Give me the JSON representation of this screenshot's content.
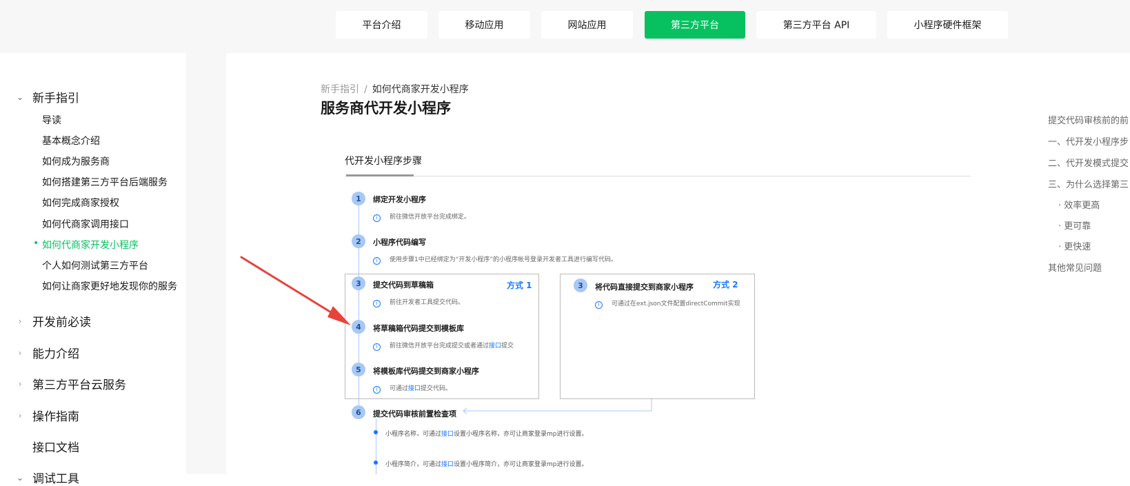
{
  "nav": {
    "items": [
      {
        "label": "平台介绍"
      },
      {
        "label": "移动应用"
      },
      {
        "label": "网站应用"
      },
      {
        "label": "第三方平台"
      },
      {
        "label": "第三方平台 API"
      },
      {
        "label": "小程序硬件框架"
      }
    ],
    "active_color": "#07c160"
  },
  "sidebar": {
    "sections": [
      {
        "label": "新手指引",
        "expanded": true,
        "icon": "chevron-down-icon"
      },
      {
        "label": "开发前必读",
        "icon": "chevron-right-icon"
      },
      {
        "label": "能力介绍",
        "icon": "chevron-right-icon"
      },
      {
        "label": "第三方平台云服务",
        "icon": "chevron-right-icon"
      },
      {
        "label": "操作指南",
        "icon": "chevron-right-icon"
      },
      {
        "label": "接口文档"
      },
      {
        "label": "调试工具",
        "icon": "chevron-down-icon"
      }
    ],
    "sub_items": [
      {
        "label": "导读"
      },
      {
        "label": "基本概念介绍"
      },
      {
        "label": "如何成为服务商"
      },
      {
        "label": "如何搭建第三方平台后端服务"
      },
      {
        "label": "如何完成商家授权"
      },
      {
        "label": "如何代商家调用接口"
      },
      {
        "label": "如何代商家开发小程序",
        "current": true
      },
      {
        "label": "个人如何测试第三方平台"
      },
      {
        "label": "如何让商家更好地发现你的服务"
      }
    ]
  },
  "main": {
    "breadcrumb": {
      "parent": "新手指引",
      "separator": "/",
      "current": "如何代商家开发小程序"
    },
    "title": "服务商代开发小程序",
    "tab": "代开发小程序步骤",
    "diagram": {
      "method1": "方式 1",
      "method2": "方式 2",
      "steps": [
        {
          "num": "1",
          "title": "绑定开发小程序",
          "desc": "前往微信开放平台完成绑定。"
        },
        {
          "num": "2",
          "title": "小程序代码编写",
          "desc": "使用步骤1中已经绑定为“开发小程序”的小程序帐号登录开发者工具进行编写代码。"
        },
        {
          "num": "3",
          "title": "提交代码到草稿箱",
          "desc": "前往开发者工具提交代码。"
        },
        {
          "num": "4",
          "title": "将草稿箱代码提交到模板库",
          "desc_pre": "前往微信开放平台完成提交或者通过",
          "desc_link": "接口",
          "desc_post": "提交"
        },
        {
          "num": "5",
          "title": "将模板库代码提交到商家小程序",
          "desc_pre": "可通过",
          "desc_link": "接口",
          "desc_post": "提交代码。"
        },
        {
          "num": "3",
          "title": "将代码直接提交到商家小程序",
          "desc": "可通过在ext.json文件配置directCommit实现"
        },
        {
          "num": "6",
          "title": "提交代码审核前置检查项"
        }
      ],
      "bullets": [
        {
          "pre": "小程序名称，可通过",
          "link": "接口",
          "post": "设置小程序名称，亦可让商家登录mp进行设置。"
        },
        {
          "pre": "小程序简介，可通过",
          "link": "接口",
          "post": "设置小程序简介，亦可让商家登录mp进行设置。"
        }
      ]
    }
  },
  "toc": {
    "items": [
      {
        "label": "提交代码审核前的前"
      },
      {
        "label": "一、代开发小程序步"
      },
      {
        "label": "二、代开发模式提交"
      },
      {
        "label": "三、为什么选择第三"
      },
      {
        "label": "· 效率更高"
      },
      {
        "label": "· 更可靠"
      },
      {
        "label": "· 更快速"
      },
      {
        "label": "其他常见问题"
      }
    ]
  },
  "colors": {
    "accent": "#07c160",
    "link": "#1677ff",
    "arrow": "#e8423a"
  }
}
